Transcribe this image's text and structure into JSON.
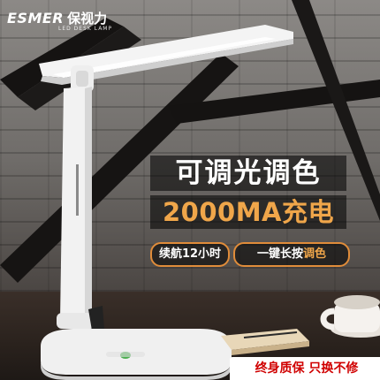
{
  "brand": {
    "logo_text": "ESMER",
    "chinese_name": "保视力",
    "tagline": "LED DESK LAMP"
  },
  "promo": {
    "headline": "可调光调色",
    "subline": "2000MA充电",
    "feature_1": "续航12小时",
    "feature_2_prefix": "一键长按",
    "feature_2_accent": "调色"
  },
  "footer": {
    "guarantee": "终身质保 只换不修"
  },
  "colors": {
    "accent": "#f0a64a",
    "warning_red": "#d00000",
    "overlay": "#000000"
  }
}
